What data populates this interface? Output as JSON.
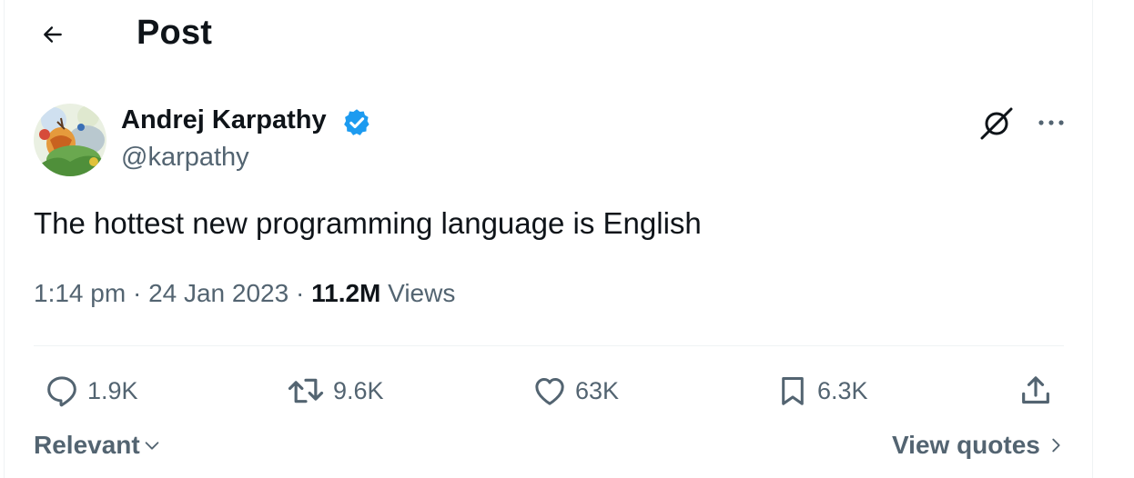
{
  "header": {
    "title": "Post"
  },
  "author": {
    "name": "Andrej Karpathy",
    "handle": "@karpathy"
  },
  "post": {
    "text": "The hottest new programming language is English"
  },
  "meta": {
    "time": "1:14 pm",
    "separator": "·",
    "date": "24 Jan 2023",
    "views_count": "11.2M",
    "views_label": "Views"
  },
  "actions": {
    "replies": "1.9K",
    "reposts": "9.6K",
    "likes": "63K",
    "bookmarks": "6.3K"
  },
  "footer": {
    "sort_label": "Relevant",
    "quotes_label": "View quotes"
  },
  "colors": {
    "text": "#0f1419",
    "secondary": "#536471",
    "verified": "#1d9bf0",
    "divider": "#eff3f4"
  },
  "icons": [
    "back-arrow-icon",
    "verified-badge-icon",
    "grok-icon",
    "more-icon",
    "reply-icon",
    "repost-icon",
    "like-icon",
    "bookmark-icon",
    "share-icon",
    "chevron-down-icon",
    "chevron-right-icon"
  ]
}
